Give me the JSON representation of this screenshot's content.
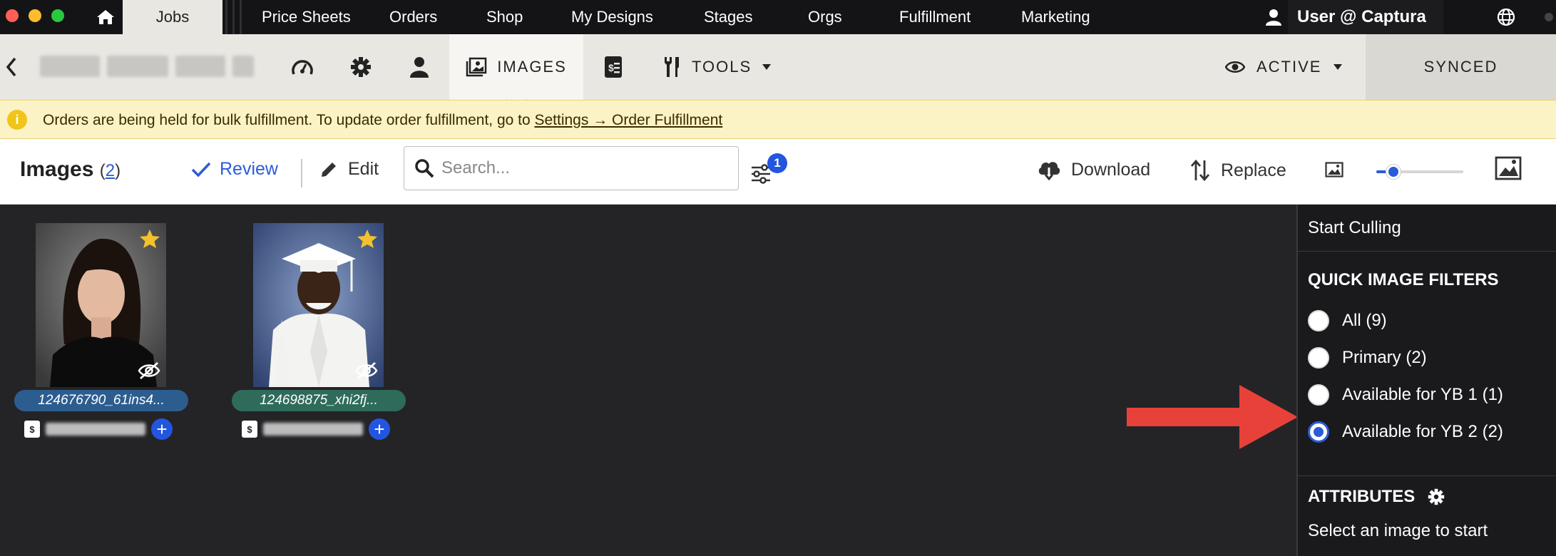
{
  "nav": {
    "jobs": "Jobs",
    "items": [
      "Price Sheets",
      "Orders",
      "Shop",
      "My Designs",
      "Stages",
      "Orgs",
      "Fulfillment",
      "Marketing"
    ],
    "user": "User @ Captura"
  },
  "toolbar": {
    "images_label": "IMAGES",
    "tools_label": "TOOLS",
    "active_label": "ACTIVE",
    "synced_label": "SYNCED"
  },
  "banner": {
    "text": "Orders are being held for bulk fulfillment. To update order fulfillment, go to ",
    "link": "Settings → Order Fulfillment"
  },
  "images_header": {
    "title": "Images",
    "count": "2",
    "review": "Review",
    "edit": "Edit",
    "search_placeholder": "Search...",
    "filter_badge": "1",
    "download": "Download",
    "replace": "Replace",
    "thumb_size_fraction": 0.2
  },
  "images": [
    {
      "filename": "124676790_61ins4...",
      "tag_color": "#2d5d8f",
      "starred": true,
      "hidden": true
    },
    {
      "filename": "124698875_xhi2fj...",
      "tag_color": "#2f6b5b",
      "starred": true,
      "hidden": true
    }
  ],
  "panel": {
    "start_culling": "Start Culling",
    "quick_filters_title": "QUICK IMAGE FILTERS",
    "filters": [
      {
        "label": "All (9)",
        "selected": false
      },
      {
        "label": "Primary (2)",
        "selected": false
      },
      {
        "label": "Available for YB 1 (1)",
        "selected": false
      },
      {
        "label": "Available for YB 2 (2)",
        "selected": true
      }
    ],
    "attributes_title": "ATTRIBUTES",
    "attributes_hint": "Select an image to start"
  },
  "colors": {
    "accent": "#2b5bd7",
    "banner_bg": "#fbf3c6",
    "arrow": "#e8413a",
    "star": "#f2c12e"
  }
}
